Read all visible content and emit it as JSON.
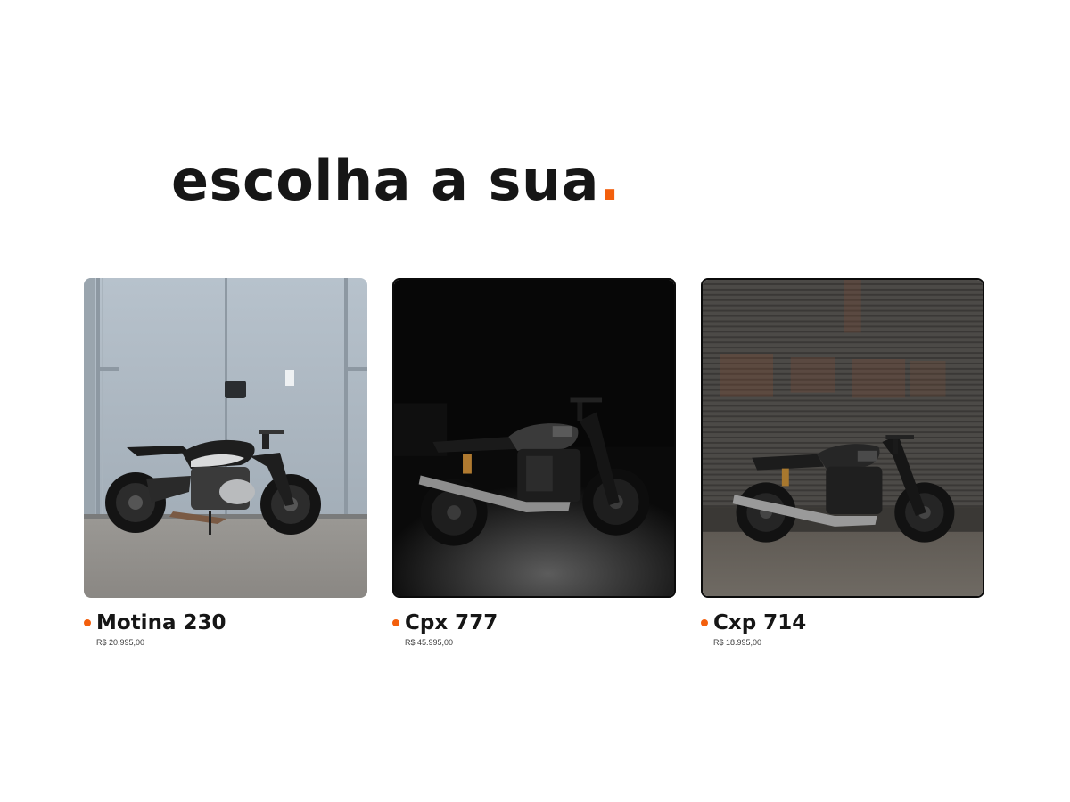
{
  "heading": {
    "text": "escolha a sua",
    "dot": "."
  },
  "colors": {
    "accent": "#f35f0c",
    "text": "#161616"
  },
  "products": [
    {
      "name": "Motina 230",
      "price": "R$ 20.995,00",
      "image": "motorcycle-photo-white-garage"
    },
    {
      "name": "Cpx 777",
      "price": "R$ 45.995,00",
      "image": "motorcycle-photo-dark-studio"
    },
    {
      "name": "Cxp 714",
      "price": "R$ 18.995,00",
      "image": "motorcycle-photo-shutter-wall"
    }
  ]
}
